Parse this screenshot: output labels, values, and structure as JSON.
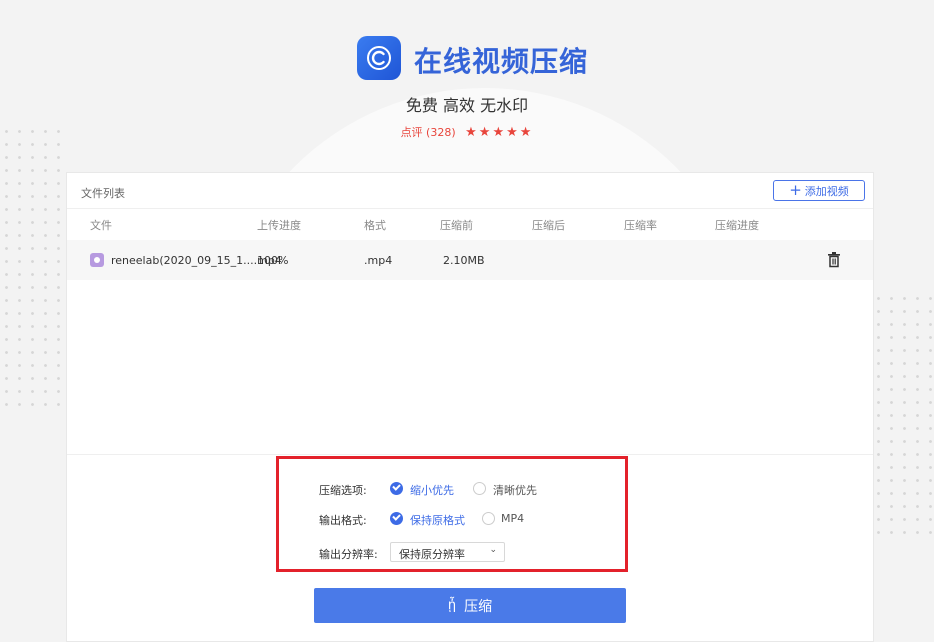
{
  "app": {
    "title": "在线视频压缩",
    "subtitle": "免费 高效 无水印",
    "rating_label": "点评 (328)",
    "stars": "★★★★★",
    "accent_color": "#3564d8"
  },
  "panel": {
    "title": "文件列表",
    "add_button": "添加视频",
    "columns": [
      "文件",
      "上传进度",
      "格式",
      "压缩前",
      "压缩后",
      "压缩率",
      "压缩进度"
    ],
    "rows": [
      {
        "file": "reneelab(2020_09_15_1....mp4",
        "progress": "100%",
        "format": ".mp4",
        "before": "2.10MB",
        "after": "",
        "ratio": "",
        "compress_progress": ""
      }
    ]
  },
  "options": {
    "compress_label": "压缩选项:",
    "compress_choices": [
      "缩小优先",
      "清晰优先"
    ],
    "compress_selected": "缩小优先",
    "format_label": "输出格式:",
    "format_choices": [
      "保持原格式",
      "MP4"
    ],
    "format_selected": "保持原格式",
    "resolution_label": "输出分辨率:",
    "resolution_value": "保持原分辨率"
  },
  "compress_button": "压缩"
}
